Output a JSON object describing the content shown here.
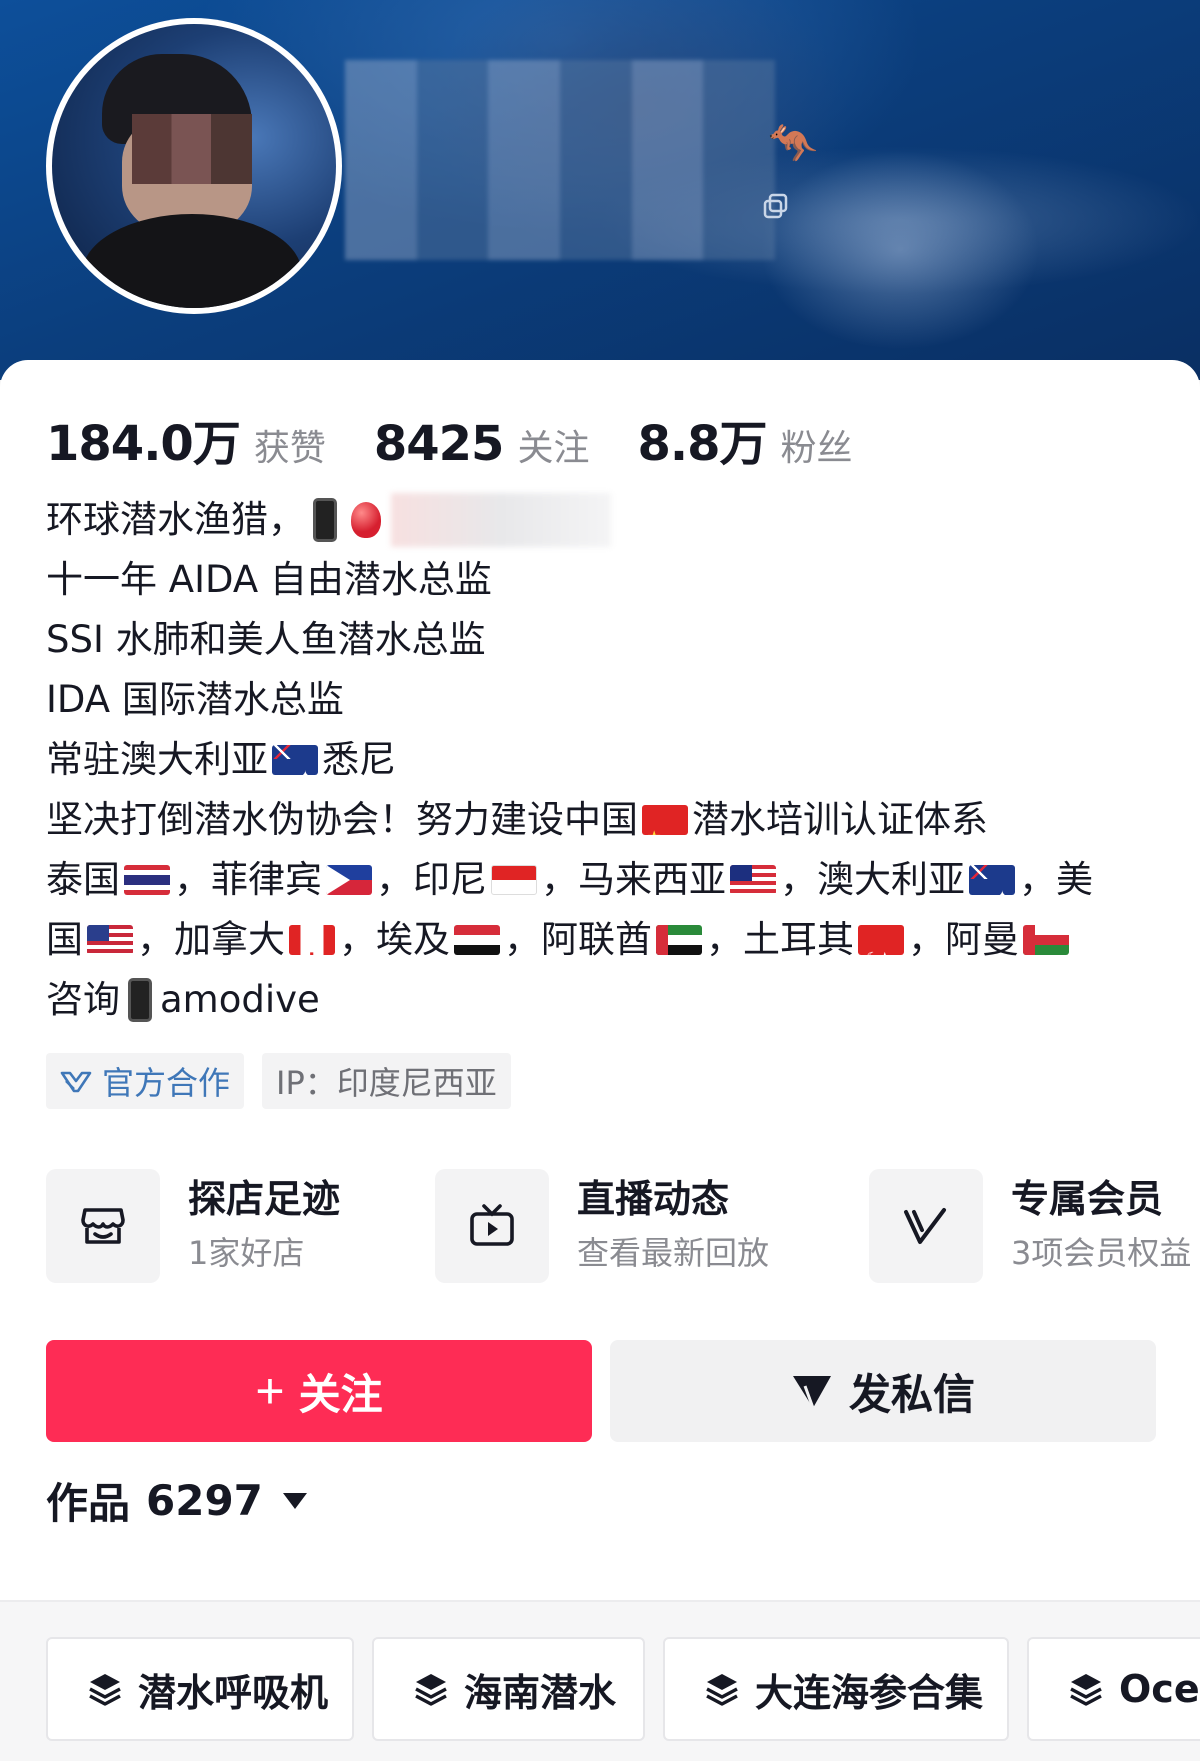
{
  "profile": {
    "stats": [
      {
        "value": "184.0万",
        "label": "获赞"
      },
      {
        "value": "8425",
        "label": "关注"
      },
      {
        "value": "8.8万",
        "label": "粉丝"
      }
    ],
    "bio": {
      "line1": "环球潜水渔猎，",
      "line2": "十一年 AIDA 自由潜水总监",
      "line3": "SSI 水肺和美人鱼潜水总监",
      "line4": "IDA 国际潜水总监",
      "line5_a": "常驻澳大利亚",
      "line5_b": "悉尼",
      "line6_a": "坚决打倒潜水伪协会！努力建设中国",
      "line6_b": "潜水培训认证体系",
      "line7": [
        "泰国",
        "，菲律宾",
        "，印尼",
        "，马来西亚",
        "，澳大利亚",
        "，美"
      ],
      "line8": [
        "国",
        "，加拿大",
        "，埃及",
        "，阿联酋",
        "，土耳其",
        "，阿曼"
      ],
      "line9_a": "咨询",
      "line9_b": "amodive"
    },
    "tags": {
      "official": "官方合作",
      "ip": "IP：印度尼西亚"
    }
  },
  "services": [
    {
      "title": "探店足迹",
      "subtitle": "1家好店",
      "icon": "store-icon"
    },
    {
      "title": "直播动态",
      "subtitle": "查看最新回放",
      "icon": "live-tv-icon"
    },
    {
      "title": "专属会员",
      "subtitle": "3项会员权益",
      "icon": "vip-v-icon"
    }
  ],
  "actions": {
    "follow_plus": "+",
    "follow_label": "关注",
    "message_label": "发私信"
  },
  "works": {
    "label": "作品",
    "count": "6297"
  },
  "collections": [
    {
      "label": "潜水呼吸机"
    },
    {
      "label": "海南潜水"
    },
    {
      "label": "大连海参合集"
    },
    {
      "label": "Ocea"
    }
  ],
  "colors": {
    "accent": "#fe2c55",
    "official_blue": "#3f77b8",
    "cover_blue": "#0b3e7d"
  }
}
